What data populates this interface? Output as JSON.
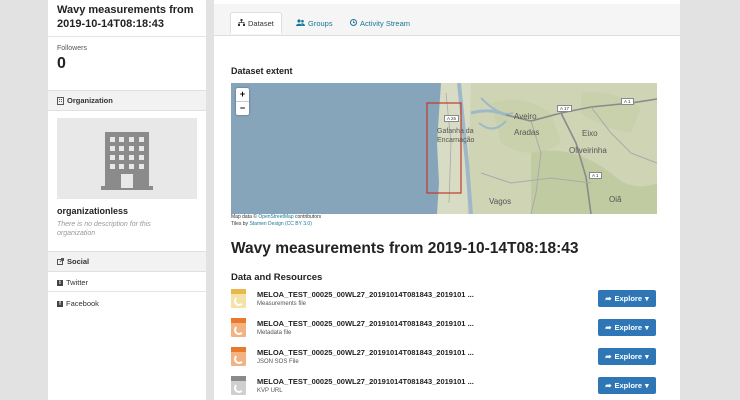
{
  "sidebar": {
    "dataset_title": "Wavy measurements from 2019-10-14T08:18:43",
    "followers_label": "Followers",
    "followers_count": "0",
    "organization_heading": "Organization",
    "organization_name": "organizationless",
    "organization_description": "There is no description for this organization",
    "social_heading": "Social",
    "social_links": [
      "Twitter",
      "Facebook"
    ]
  },
  "tabs": [
    {
      "label": "Dataset",
      "icon": "sitemap-icon",
      "active": true
    },
    {
      "label": "Groups",
      "icon": "users-icon",
      "active": false
    },
    {
      "label": "Activity Stream",
      "icon": "clock-icon",
      "active": false
    }
  ],
  "map": {
    "heading": "Dataset extent",
    "zoom_in": "+",
    "zoom_out": "−",
    "places": [
      "Aveiro",
      "Gafanha da Encarnação",
      "Aradas",
      "Eixo",
      "Oliveirinha",
      "Vagos",
      "Oiã"
    ],
    "road_labels": [
      "A 17",
      "A 1",
      "A 25",
      "A 1"
    ],
    "attribution_prefix": "Map data © ",
    "attribution_osm": "OpenStreetMap",
    "attribution_osm_suffix": " contributors",
    "tiles_prefix": "Tiles by ",
    "tiles_link": "Stamen Design",
    "tiles_license": " (CC BY 3.0)",
    "extent_color": "#c0392b"
  },
  "main": {
    "dataset_title": "Wavy measurements from 2019-10-14T08:18:43",
    "resources_heading": "Data and Resources",
    "explore_label": "Explore"
  },
  "resources": [
    {
      "name": "MELOA_TEST_00025_00WL27_20191014T081843_2019101 ...",
      "description": "Measurements file",
      "format_color": "#e8b84a"
    },
    {
      "name": "MELOA_TEST_00025_00WL27_20191014T081843_2019101 ...",
      "description": "Metadata file",
      "format_color": "#e87a2c"
    },
    {
      "name": "MELOA_TEST_00025_00WL27_20191014T081843_2019101 ...",
      "description": "JSON SOS File",
      "format_color": "#e87a2c"
    },
    {
      "name": "MELOA_TEST_00025_00WL27_20191014T081843_2019101 ...",
      "description": "KVP URL",
      "format_color": "#8a8a8a"
    }
  ],
  "colors": {
    "link": "#187794",
    "button": "#2f76b7"
  }
}
